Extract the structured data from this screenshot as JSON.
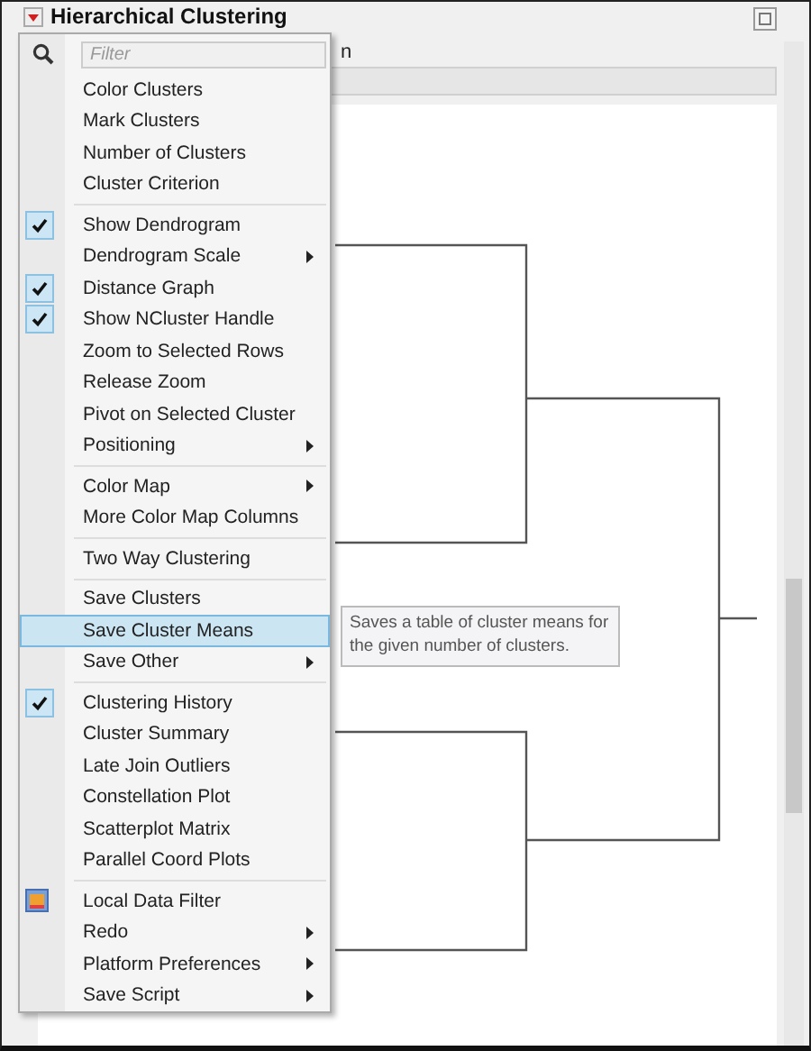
{
  "window": {
    "title": "Hierarchical Clustering",
    "subtitle_fragment": "n"
  },
  "menu": {
    "filter": {
      "placeholder": "Filter"
    },
    "groups": [
      {
        "items": [
          {
            "label": "Color Clusters",
            "kind": "plain",
            "checked": false,
            "submenu": false,
            "selected": false
          },
          {
            "label": "Mark Clusters",
            "kind": "plain",
            "checked": false,
            "submenu": false,
            "selected": false
          },
          {
            "label": "Number of Clusters",
            "kind": "plain",
            "checked": false,
            "submenu": false,
            "selected": false
          },
          {
            "label": "Cluster Criterion",
            "kind": "plain",
            "checked": false,
            "submenu": false,
            "selected": false
          }
        ]
      },
      {
        "items": [
          {
            "label": "Show Dendrogram",
            "kind": "plain",
            "checked": true,
            "submenu": false,
            "selected": false
          },
          {
            "label": "Dendrogram Scale",
            "kind": "plain",
            "checked": false,
            "submenu": true,
            "selected": false
          },
          {
            "label": "Distance Graph",
            "kind": "plain",
            "checked": true,
            "submenu": false,
            "selected": false
          },
          {
            "label": "Show NCluster Handle",
            "kind": "plain",
            "checked": true,
            "submenu": false,
            "selected": false
          },
          {
            "label": "Zoom to Selected Rows",
            "kind": "plain",
            "checked": false,
            "submenu": false,
            "selected": false
          },
          {
            "label": "Release Zoom",
            "kind": "plain",
            "checked": false,
            "submenu": false,
            "selected": false
          },
          {
            "label": "Pivot on Selected Cluster",
            "kind": "plain",
            "checked": false,
            "submenu": false,
            "selected": false
          },
          {
            "label": "Positioning",
            "kind": "plain",
            "checked": false,
            "submenu": true,
            "selected": false
          }
        ]
      },
      {
        "items": [
          {
            "label": "Color Map",
            "kind": "plain",
            "checked": false,
            "submenu": true,
            "selected": false
          },
          {
            "label": "More Color Map Columns",
            "kind": "plain",
            "checked": false,
            "submenu": false,
            "selected": false
          }
        ]
      },
      {
        "items": [
          {
            "label": "Two Way Clustering",
            "kind": "plain",
            "checked": false,
            "submenu": false,
            "selected": false
          }
        ]
      },
      {
        "items": [
          {
            "label": "Save Clusters",
            "kind": "plain",
            "checked": false,
            "submenu": false,
            "selected": false
          },
          {
            "label": "Save Cluster Means",
            "kind": "plain",
            "checked": false,
            "submenu": false,
            "selected": true
          },
          {
            "label": "Save Other",
            "kind": "plain",
            "checked": false,
            "submenu": true,
            "selected": false
          }
        ]
      },
      {
        "items": [
          {
            "label": "Clustering History",
            "kind": "plain",
            "checked": true,
            "submenu": false,
            "selected": false
          },
          {
            "label": "Cluster Summary",
            "kind": "plain",
            "checked": false,
            "submenu": false,
            "selected": false
          },
          {
            "label": "Late Join Outliers",
            "kind": "plain",
            "checked": false,
            "submenu": false,
            "selected": false
          },
          {
            "label": "Constellation Plot",
            "kind": "plain",
            "checked": false,
            "submenu": false,
            "selected": false
          },
          {
            "label": "Scatterplot Matrix",
            "kind": "plain",
            "checked": false,
            "submenu": false,
            "selected": false
          },
          {
            "label": "Parallel Coord Plots",
            "kind": "plain",
            "checked": false,
            "submenu": false,
            "selected": false
          }
        ]
      },
      {
        "items": [
          {
            "label": "Local Data Filter",
            "kind": "icon",
            "checked": false,
            "submenu": false,
            "selected": false
          },
          {
            "label": "Redo",
            "kind": "plain",
            "checked": false,
            "submenu": true,
            "selected": false
          },
          {
            "label": "Platform Preferences",
            "kind": "plain",
            "checked": false,
            "submenu": true,
            "selected": false
          },
          {
            "label": "Save Script",
            "kind": "plain",
            "checked": false,
            "submenu": true,
            "selected": false
          }
        ]
      }
    ]
  },
  "tooltip": {
    "text": "Saves a table of cluster means for the given number of clusters."
  }
}
